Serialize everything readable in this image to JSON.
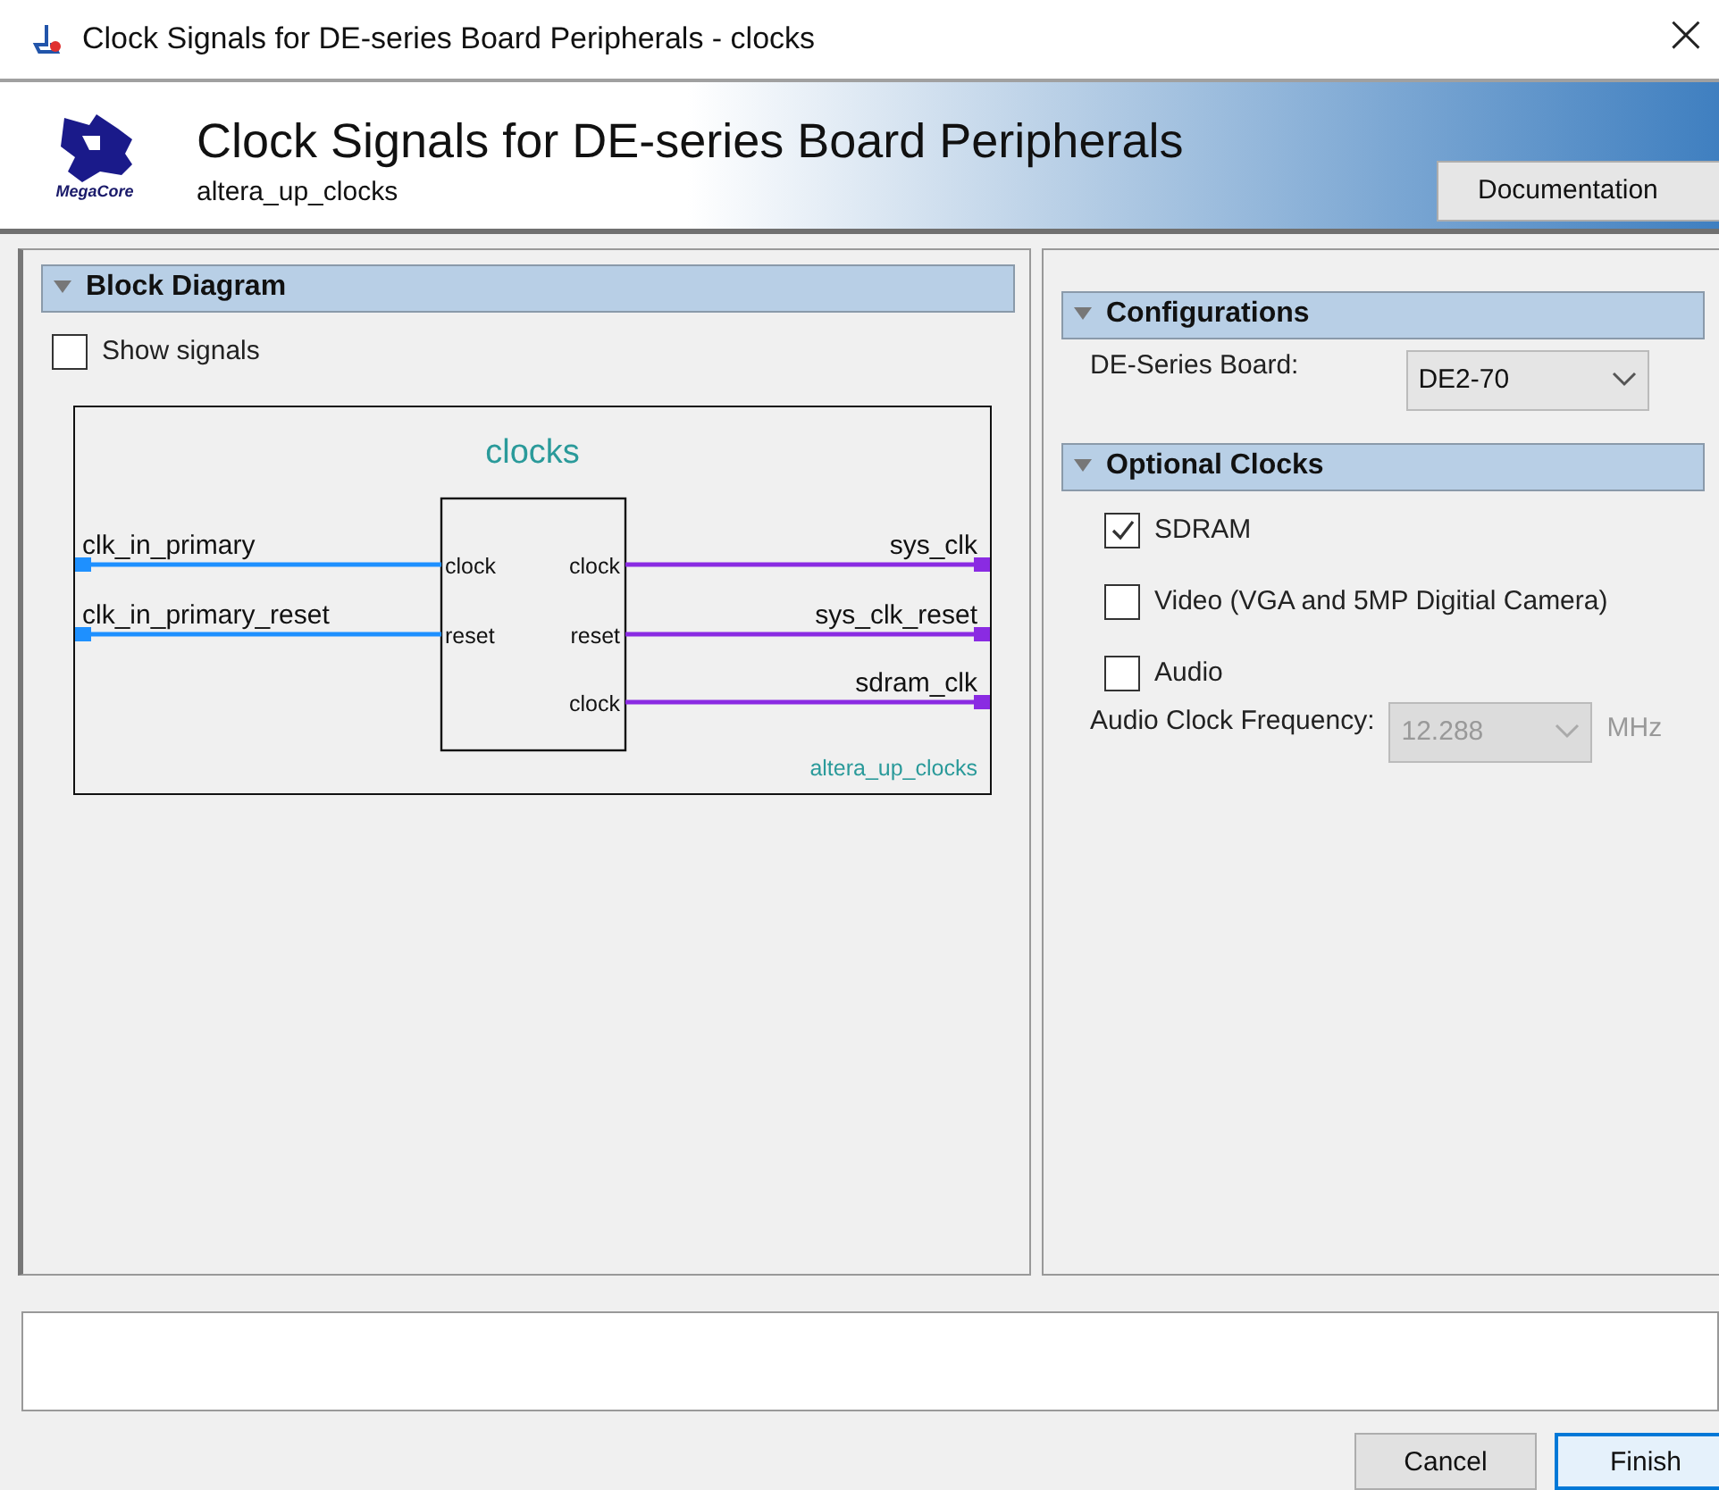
{
  "window": {
    "title": "Clock Signals for DE-series Board Peripherals - clocks",
    "close": "×"
  },
  "header": {
    "logo": "MegaCore",
    "title": "Clock Signals for DE-series Board Peripherals",
    "subtitle": "altera_up_clocks",
    "documentation": "Documentation"
  },
  "block_diagram": {
    "title": "Block Diagram",
    "expanded": true,
    "show_signals": {
      "label": "Show signals",
      "checked": false
    },
    "diagram": {
      "name": "clocks",
      "instance": "altera_up_clocks",
      "inputs": [
        {
          "signal": "clk_in_primary",
          "port": "clock"
        },
        {
          "signal": "clk_in_primary_reset",
          "port": "reset"
        }
      ],
      "outputs": [
        {
          "signal": "sys_clk",
          "port": "clock"
        },
        {
          "signal": "sys_clk_reset",
          "port": "reset"
        },
        {
          "signal": "sdram_clk",
          "port": "clock"
        }
      ]
    }
  },
  "configurations": {
    "title": "Configurations",
    "expanded": true,
    "board": {
      "label": "DE-Series Board:",
      "value": "DE2-70"
    }
  },
  "optional_clocks": {
    "title": "Optional Clocks",
    "expanded": true,
    "options": [
      {
        "label": "SDRAM",
        "checked": true
      },
      {
        "label": "Video (VGA and 5MP Digitial Camera)",
        "checked": false
      },
      {
        "label": "Audio",
        "checked": false
      }
    ],
    "frequency": {
      "label": "Audio Clock Frequency:",
      "value": "12.288",
      "unit": "MHz",
      "disabled": true
    }
  },
  "buttons": [
    {
      "label": "Cancel",
      "selected": false
    },
    {
      "label": "Finish",
      "selected": true
    }
  ]
}
